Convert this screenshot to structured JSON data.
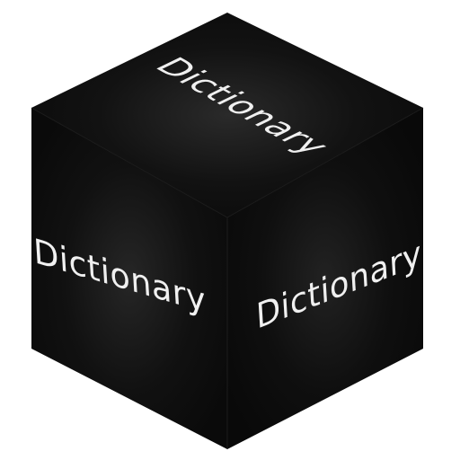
{
  "cube": {
    "faces": {
      "top": {
        "label": "Dictionary"
      },
      "left": {
        "label": "Dictionary"
      },
      "right": {
        "label": "Dictionary"
      }
    },
    "colors": {
      "face_center_glow": "#2a2a2a",
      "face_base": "#0b0b0b",
      "text": "#f0f0f0",
      "background": "#ffffff"
    }
  }
}
